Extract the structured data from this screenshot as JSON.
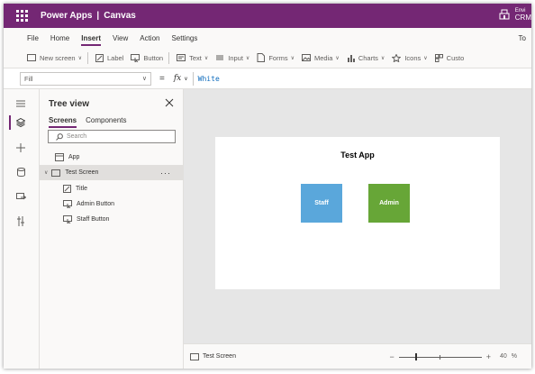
{
  "titlebar": {
    "app_name": "Power Apps",
    "separator": "|",
    "studio": "Canvas",
    "env_label": "Envi",
    "env_name": "CRM"
  },
  "menu": {
    "items": [
      "File",
      "Home",
      "Insert",
      "View",
      "Action",
      "Settings"
    ],
    "active": "Insert",
    "right_text": "To"
  },
  "ribbon": {
    "new_screen": "New screen",
    "label": "Label",
    "button": "Button",
    "text": "Text",
    "input": "Input",
    "forms": "Forms",
    "media": "Media",
    "charts": "Charts",
    "icons": "Icons",
    "custom": "Custo"
  },
  "formula": {
    "property": "Fill",
    "equals": "=",
    "fx": "fx",
    "value": "White"
  },
  "tree": {
    "title": "Tree view",
    "tabs": [
      "Screens",
      "Components"
    ],
    "search_placeholder": "Search",
    "nodes": {
      "app": "App",
      "screen": "Test Screen",
      "title": "Title",
      "admin_button": "Admin Button",
      "staff_button": "Staff Button"
    },
    "more": "···"
  },
  "canvas": {
    "app_title": "Test App",
    "staff_label": "Staff",
    "admin_label": "Admin"
  },
  "status": {
    "screen": "Test Screen",
    "zoom_minus": "−",
    "zoom_plus": "+",
    "zoom_value": "40",
    "zoom_unit": "%",
    "zoom_level": 0.4
  },
  "colors": {
    "brand": "#742774",
    "staff_button": "#5aa7db",
    "admin_button": "#67a637",
    "formula_text": "#0f6cbd"
  }
}
